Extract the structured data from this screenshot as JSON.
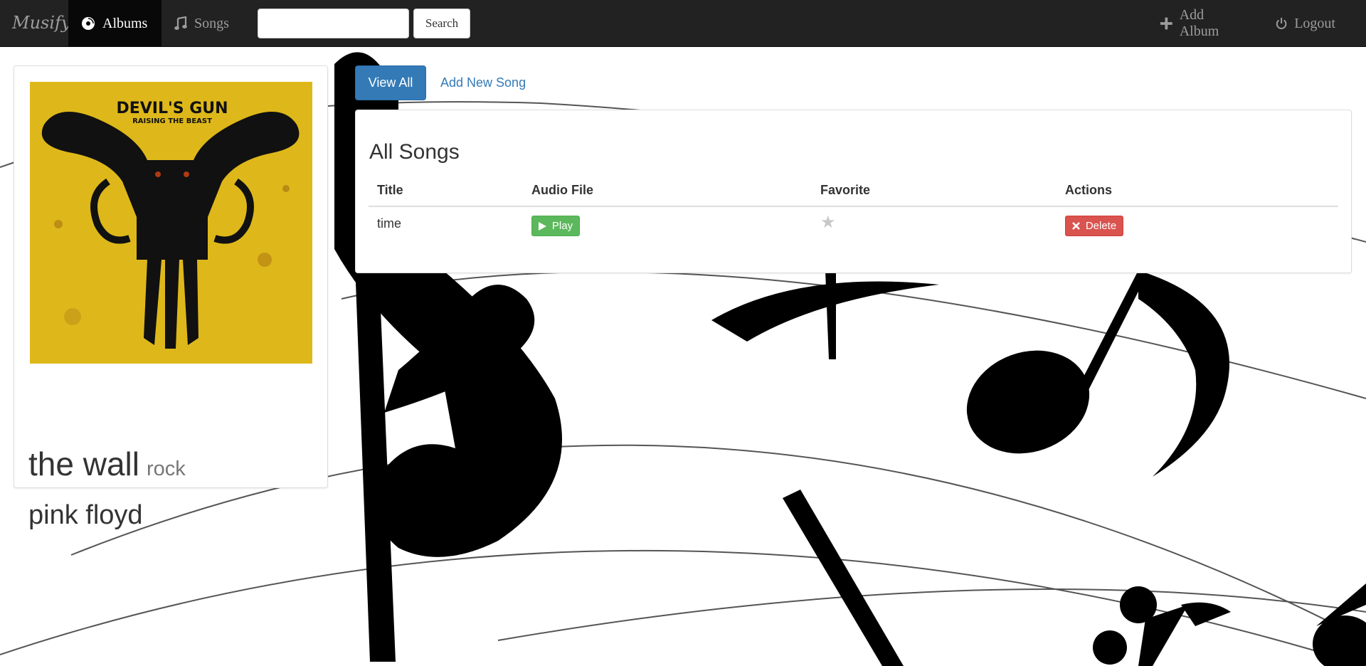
{
  "navbar": {
    "brand": "Musify",
    "links": [
      {
        "label": "Albums",
        "icon": "disc-icon",
        "active": true
      },
      {
        "label": "Songs",
        "icon": "music-note-icon",
        "active": false
      }
    ],
    "search": {
      "value": "",
      "placeholder": "",
      "button_label": "Search"
    },
    "right_links": [
      {
        "label": "Add Album",
        "icon": "plus-icon"
      },
      {
        "label": "Logout",
        "icon": "power-icon"
      }
    ]
  },
  "album": {
    "title": "the wall",
    "genre": "rock",
    "artist": "pink floyd",
    "cover": {
      "line1": "DEVIL'S GUN",
      "line2": "RAISING THE BEAST"
    }
  },
  "tabs": {
    "view_all": "View All",
    "add_new_song": "Add New Song"
  },
  "songs": {
    "heading": "All Songs",
    "columns": [
      "Title",
      "Audio File",
      "Favorite",
      "Actions"
    ],
    "rows": [
      {
        "title": "time",
        "play_label": "Play",
        "favorite": false,
        "delete_label": "Delete"
      }
    ]
  },
  "colors": {
    "navbar": "#222222",
    "primary": "#337ab7",
    "success": "#5cb85c",
    "danger": "#d9534f",
    "cover_yellow": "#e7c21a"
  }
}
